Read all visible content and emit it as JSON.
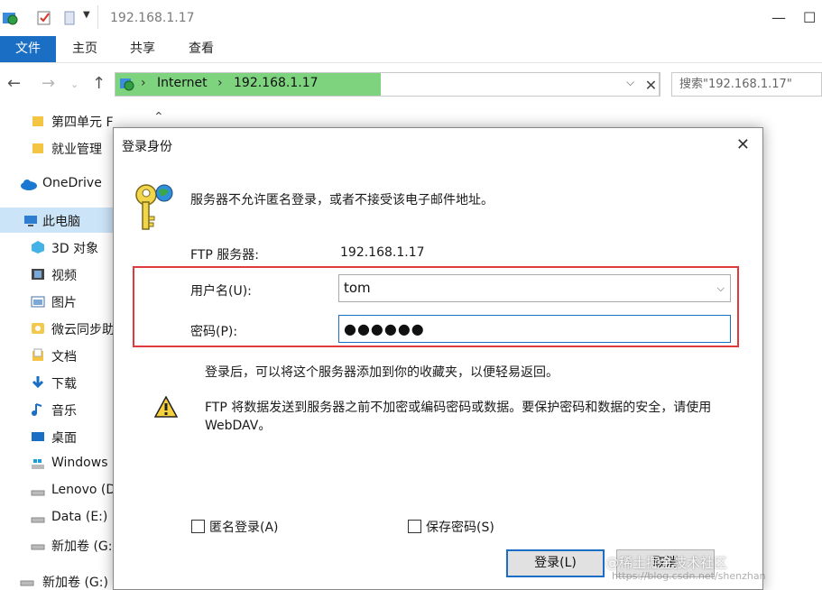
{
  "window": {
    "title": "192.168.1.17",
    "controls": {
      "minimize": "—",
      "maximize": "☐"
    }
  },
  "ribbon": {
    "file_tab": "文件",
    "tabs": [
      "主页",
      "共享",
      "查看"
    ]
  },
  "address_bar": {
    "segments": [
      "Internet",
      "192.168.1.17"
    ],
    "search_placeholder": "搜索\"192.168.1.17\""
  },
  "sidebar": {
    "items": [
      {
        "label": "第四单元 FTP服务",
        "icon": "folder-icon"
      },
      {
        "label": "就业管理",
        "icon": "folder-icon"
      },
      {
        "label": "OneDrive",
        "icon": "cloud-icon"
      },
      {
        "label": "此电脑",
        "icon": "computer-icon",
        "selected": true
      },
      {
        "label": "3D 对象",
        "icon": "cube-icon"
      },
      {
        "label": "视频",
        "icon": "film-icon"
      },
      {
        "label": "图片",
        "icon": "picture-icon"
      },
      {
        "label": "微云同步助",
        "icon": "cloud-sync-icon"
      },
      {
        "label": "文档",
        "icon": "document-icon"
      },
      {
        "label": "下载",
        "icon": "download-icon"
      },
      {
        "label": "音乐",
        "icon": "music-icon"
      },
      {
        "label": "桌面",
        "icon": "desktop-icon"
      },
      {
        "label": "Windows",
        "icon": "drive-windows-icon"
      },
      {
        "label": "Lenovo (D",
        "icon": "drive-icon"
      },
      {
        "label": "Data (E:)",
        "icon": "drive-icon"
      },
      {
        "label": "新加卷 (G:",
        "icon": "drive-icon"
      },
      {
        "label": "新加卷 (G:)",
        "icon": "drive-icon"
      }
    ]
  },
  "dialog": {
    "title": "登录身份",
    "message": "服务器不允许匿名登录，或者不接受该电子邮件地址。",
    "server_label": "FTP 服务器:",
    "server_value": "192.168.1.17",
    "username_label": "用户名(U):",
    "username_value": "tom",
    "password_label": "密码(P):",
    "password_value": "●●●●●●",
    "info_text": "登录后，可以将这个服务器添加到你的收藏夹，以便轻易返回。",
    "warning_line1": "FTP 将数据发送到服务器之前不加密或编码密码或数据。要保护密码和数据的安全，请使用",
    "warning_line2": "WebDAV。",
    "anonymous_label": "匿名登录(A)",
    "save_password_label": "保存密码(S)",
    "login_button": "登录(L)",
    "cancel_button": "取消"
  },
  "watermark": {
    "text": "@稀土掘金技术社区",
    "url": "https://blog.csdn.net/shenzhan"
  },
  "colors": {
    "accent": "#1a6fc4",
    "address_highlight": "#7ed37f",
    "annotation_red": "#e0393e",
    "selected_bg": "#cce4f7"
  }
}
